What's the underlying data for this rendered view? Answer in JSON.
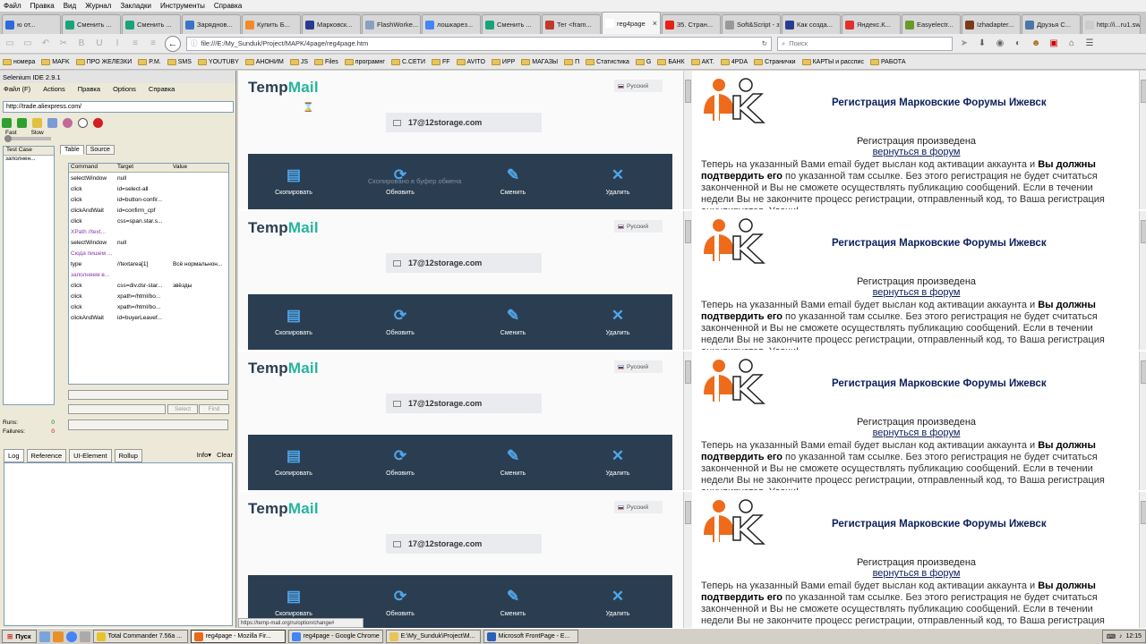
{
  "menu": [
    "Файл",
    "Правка",
    "Вид",
    "Журнал",
    "Закладки",
    "Инструменты",
    "Справка"
  ],
  "tabs": [
    {
      "label": "ю от...",
      "color": "#2d6bd8"
    },
    {
      "label": "Сменить ...",
      "color": "#1aa37a"
    },
    {
      "label": "Сменить ...",
      "color": "#1aa37a"
    },
    {
      "label": "Заряднов...",
      "color": "#3a73c8"
    },
    {
      "label": "Купить Б...",
      "color": "#f28a2b"
    },
    {
      "label": "Марковск...",
      "color": "#2a3b8f"
    },
    {
      "label": "FlashWorke...",
      "color": "#8aa0c0"
    },
    {
      "label": "лошкарез...",
      "color": "#4285f4"
    },
    {
      "label": "Сменить ...",
      "color": "#1aa37a"
    },
    {
      "label": "Тег <fram...",
      "color": "#c0392b"
    },
    {
      "label": "reg4page",
      "color": "#ffffff"
    },
    {
      "label": "35. Стран...",
      "color": "#e62117"
    },
    {
      "label": "Soft&Script - з...",
      "color": "#999999"
    },
    {
      "label": "Как созда...",
      "color": "#2a3b8f"
    },
    {
      "label": "Яндекс.К...",
      "color": "#e03030"
    },
    {
      "label": "Easyelectr...",
      "color": "#6a9a2a"
    },
    {
      "label": "Izhadapter...",
      "color": "#7a3a1a"
    },
    {
      "label": "Друзья С...",
      "color": "#4a76a8"
    },
    {
      "label": "http://i...ru1.swf",
      "color": "#cccccc"
    }
  ],
  "nav": {
    "url": "file:///E:/My_Sunduk/Project/MAPK/4page/reg4page.htm",
    "search_placeholder": "Поиск"
  },
  "bookmarks": [
    "номера",
    "MAFK",
    "ПРО ЖЕЛЕЗКИ",
    "P.M.",
    "SMS",
    "YOUTUBY",
    "АНОНИМ",
    "JS",
    "Files",
    "програмнг",
    "С.СЕТИ",
    "FF",
    "AVITO",
    "ИРР",
    "МАГАЗЫ",
    "П",
    "Статистика",
    "G",
    "БАНК",
    "АКТ.",
    "4PDA",
    "Странички",
    "КАРТЫ и расспис",
    "РАБОТА"
  ],
  "selenium": {
    "title": "Selenium IDE 2.9.1",
    "menu": [
      "Файл (F)",
      "Actions",
      "Правка",
      "Options",
      "Справка"
    ],
    "base_url": "http://trade.aliexpress.com/",
    "speed_fast": "Fast",
    "speed_slow": "Slow",
    "test_case_header": "Test Case",
    "test_case_item": "заполнен...",
    "tab_table": "Table",
    "tab_source": "Source",
    "col_command": "Command",
    "col_target": "Target",
    "col_value": "Value",
    "rows": [
      {
        "cmd": "selectWindow",
        "target": "null",
        "value": "",
        "purple": false
      },
      {
        "cmd": "click",
        "target": "id=select-all",
        "value": "",
        "purple": false
      },
      {
        "cmd": "click",
        "target": "id=button-confir...",
        "value": "",
        "purple": false
      },
      {
        "cmd": "clickAndWait",
        "target": "id=confirm_cpf",
        "value": "",
        "purple": false
      },
      {
        "cmd": "click",
        "target": "css=span.star.s...",
        "value": "",
        "purple": false
      },
      {
        "cmd": "XPath   //text...",
        "target": "",
        "value": "",
        "purple": true
      },
      {
        "cmd": "selectWindow",
        "target": "null",
        "value": "",
        "purple": false
      },
      {
        "cmd": "Сюда пишем ...",
        "target": "",
        "value": "",
        "purple": true
      },
      {
        "cmd": "type",
        "target": "//textarea[1]",
        "value": "Всё нормальнон...",
        "purple": false
      },
      {
        "cmd": "заполняем в...",
        "target": "",
        "value": "",
        "purple": true
      },
      {
        "cmd": "click",
        "target": "css=div.dsr-star...",
        "value": "звёзды",
        "purple": false
      },
      {
        "cmd": "click",
        "target": "xpath=/html/bo...",
        "value": "",
        "purple": false
      },
      {
        "cmd": "click",
        "target": "xpath=/html/bo...",
        "value": "",
        "purple": false
      },
      {
        "cmd": "clickAndWait",
        "target": "id=buyerLeavef...",
        "value": "",
        "purple": false
      }
    ],
    "select_btn": "Select",
    "find_btn": "Find",
    "runs_label": "Runs:",
    "runs_value": "0",
    "failures_label": "Failures:",
    "failures_value": "0",
    "log_tabs": [
      "Log",
      "Reference",
      "UI-Element",
      "Rollup"
    ],
    "info": "Info▾",
    "clear": "Clear"
  },
  "tempmail": {
    "logo_temp": "Temp",
    "logo_mail": "Mail",
    "lang": "Русский",
    "email": "17@12storage.com",
    "copy": "Скопировать",
    "refresh": "Обновить",
    "change": "Сменить",
    "delete": "Удалить",
    "notice": "Скопировано в буфер обмена"
  },
  "reg": {
    "title": "Регистрация Марковские Форумы Ижевск",
    "done": "Регистрация произведена",
    "back": "вернуться в форум",
    "text_pre": "Теперь на указанный Вами email будет выслан код активации аккаунта и ",
    "text_bold": "Вы должны подтвердить его",
    "text_post": " по указанной там ссылке. Без этого регистрация не будет считаться законченной и Вы не сможете осуществлять публикацию сообщений. Если в течении недели Вы не закончите процесс регистрации, отправленный код, то Ваша регистрация аннулируется. Удачи!"
  },
  "status_link": "https://temp-mail.org/ru/option/change#",
  "taskbar": {
    "start": "Пуск",
    "tasks": [
      {
        "label": "Total Commander 7.56a ...",
        "color": "#e8c22a"
      },
      {
        "label": "reg4page - Mozilla Fir...",
        "color": "#e86a1a"
      },
      {
        "label": "reg4page - Google Chrome",
        "color": "#4285f4"
      },
      {
        "label": "E:\\My_Sunduk\\Project\\M...",
        "color": "#e8c45a"
      },
      {
        "label": "Microsoft FrontPage - E...",
        "color": "#2b5fb8"
      }
    ],
    "clock": "12:15"
  }
}
